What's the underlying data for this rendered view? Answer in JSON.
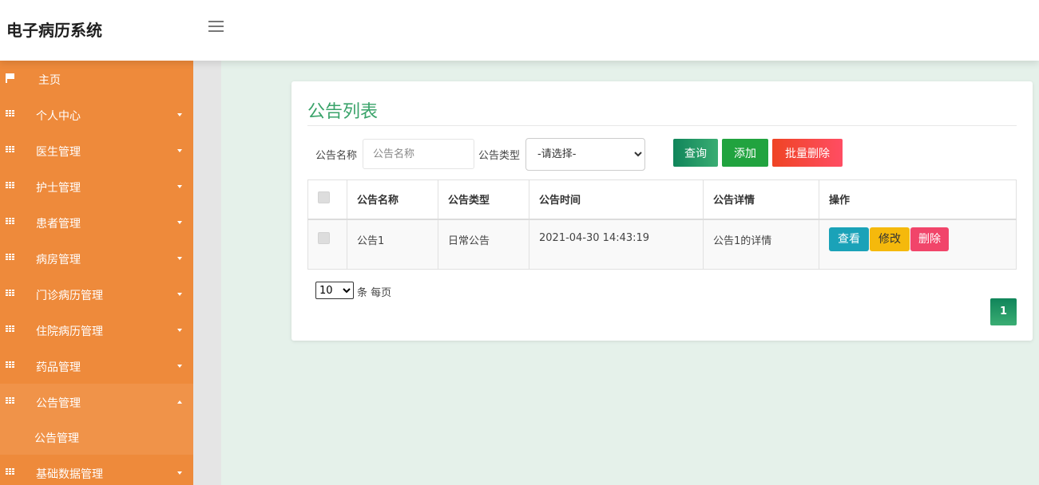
{
  "header": {
    "brand": "电子病历系统",
    "menu_icon": "hamburger-icon"
  },
  "sidebar": {
    "items": [
      {
        "label": "主页",
        "icon": "flag-icon"
      },
      {
        "label": "个人中心",
        "icon": "grid-icon"
      },
      {
        "label": "医生管理",
        "icon": "grid-icon"
      },
      {
        "label": "护士管理",
        "icon": "grid-icon"
      },
      {
        "label": "患者管理",
        "icon": "grid-icon"
      },
      {
        "label": "病房管理",
        "icon": "grid-icon"
      },
      {
        "label": "门诊病历管理",
        "icon": "grid-icon"
      },
      {
        "label": "住院病历管理",
        "icon": "grid-icon"
      },
      {
        "label": "药品管理",
        "icon": "grid-icon"
      },
      {
        "label": "公告管理",
        "icon": "grid-icon"
      },
      {
        "label": "基础数据管理",
        "icon": "grid-icon"
      }
    ],
    "sub_item": "公告管理"
  },
  "panel": {
    "title": "公告列表",
    "filter": {
      "name_label": "公告名称",
      "name_placeholder": "公告名称",
      "type_label": "公告类型",
      "type_selected": "-请选择-"
    },
    "buttons": {
      "query": "查询",
      "add": "添加",
      "batch_delete": "批量删除"
    },
    "table": {
      "headers": [
        "公告名称",
        "公告类型",
        "公告时间",
        "公告详情",
        "操作"
      ],
      "rows": [
        {
          "name": "公告1",
          "type": "日常公告",
          "time": "2021-04-30 14:43:19",
          "detail": "公告1的详情"
        }
      ],
      "actions": {
        "view": "查看",
        "edit": "修改",
        "delete": "删除"
      }
    },
    "pagination": {
      "page_size": "10",
      "page_size_text": "条 每页",
      "current_page": "1"
    }
  },
  "colors": {
    "sidebar": "#ee8a3b",
    "accent_green": "#3aa36a",
    "background": "#e5f1ea"
  }
}
